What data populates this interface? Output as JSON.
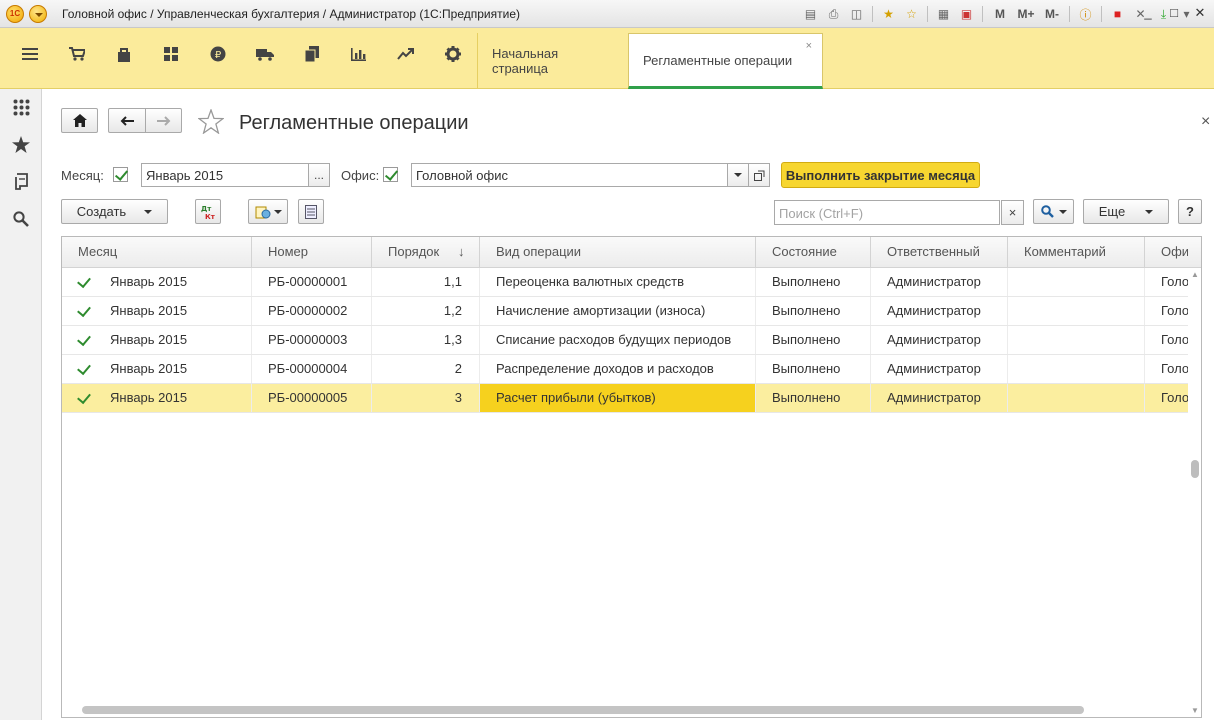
{
  "window": {
    "title": "Головной офис / Управленческая бухгалтерия / Администратор  (1С:Предприятие)",
    "memory_buttons": [
      "M",
      "M+",
      "M-"
    ],
    "controls": [
      "minimize",
      "maximize",
      "close"
    ]
  },
  "sections": [
    {
      "name": "menu",
      "icon": "hamburger-icon"
    },
    {
      "name": "cart",
      "icon": "cart-icon"
    },
    {
      "name": "bag",
      "icon": "bag-icon"
    },
    {
      "name": "warehouse",
      "icon": "grid-icon"
    },
    {
      "name": "money",
      "icon": "ruble-icon"
    },
    {
      "name": "delivery",
      "icon": "truck-icon"
    },
    {
      "name": "documents",
      "icon": "documents-icon"
    },
    {
      "name": "reports",
      "icon": "bar-chart-icon"
    },
    {
      "name": "analytics",
      "icon": "trend-icon"
    },
    {
      "name": "settings",
      "icon": "gear-icon"
    }
  ],
  "tabs": [
    {
      "label": "Начальная страница",
      "active": false
    },
    {
      "label": "Регламентные операции",
      "active": true,
      "close": "×"
    }
  ],
  "left_panel": [
    "apps-icon",
    "star-icon",
    "history-icon",
    "search-icon"
  ],
  "form": {
    "title": "Регламентные операции",
    "close": "×",
    "month_label": "Месяц:",
    "month_value": "Январь 2015",
    "month_pick": "...",
    "office_label": "Офис:",
    "office_value": "Головной офис",
    "primary_button": "Выполнить закрытие месяца",
    "create_button": "Создать",
    "dt_kt": "Дт\nКт",
    "search_placeholder": "Поиск (Ctrl+F)",
    "search_clear": "×",
    "more_button": "Еще",
    "help_button": "?"
  },
  "table": {
    "columns": [
      "Месяц",
      "Номер",
      "Порядок",
      "Вид операции",
      "Состояние",
      "Ответственный",
      "Комментарий",
      "Офис"
    ],
    "sort_indicator": "↓",
    "rows": [
      {
        "month": "Январь 2015",
        "number": "РБ-00000001",
        "order": "1,1",
        "operation": "Переоценка валютных средств",
        "state": "Выполнено",
        "responsible": "Администратор",
        "comment": "",
        "office": "Головной офис"
      },
      {
        "month": "Январь 2015",
        "number": "РБ-00000002",
        "order": "1,2",
        "operation": "Начисление амортизации (износа)",
        "state": "Выполнено",
        "responsible": "Администратор",
        "comment": "",
        "office": "Головной офис"
      },
      {
        "month": "Январь 2015",
        "number": "РБ-00000003",
        "order": "1,3",
        "operation": "Списание расходов будущих периодов",
        "state": "Выполнено",
        "responsible": "Администратор",
        "comment": "",
        "office": "Головной офис"
      },
      {
        "month": "Январь 2015",
        "number": "РБ-00000004",
        "order": "2",
        "operation": "Распределение доходов и расходов",
        "state": "Выполнено",
        "responsible": "Администратор",
        "comment": "",
        "office": "Головной офис"
      },
      {
        "month": "Январь 2015",
        "number": "РБ-00000005",
        "order": "3",
        "operation": "Расчет прибыли (убытков)",
        "state": "Выполнено",
        "responsible": "Администратор",
        "comment": "",
        "office": "Головной офис"
      }
    ],
    "selected_row": 4
  }
}
